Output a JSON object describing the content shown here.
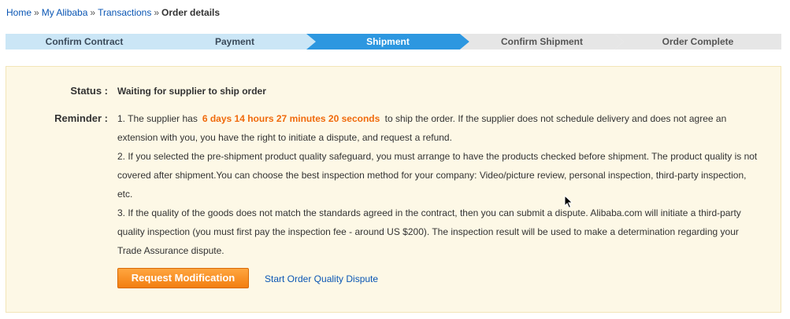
{
  "breadcrumb": {
    "items": [
      "Home",
      "My Alibaba",
      "Transactions"
    ],
    "separator": "»",
    "current": "Order details"
  },
  "steps": [
    {
      "label": "Confirm Contract",
      "state": "done"
    },
    {
      "label": "Payment",
      "state": "done"
    },
    {
      "label": "Shipment",
      "state": "current"
    },
    {
      "label": "Confirm Shipment",
      "state": "pending"
    },
    {
      "label": "Order Complete",
      "state": "pending"
    }
  ],
  "colors": {
    "step_done_bg": "#cbe6f6",
    "step_done_text": "#3a4a5a",
    "step_current_bg": "#2d97e0",
    "step_current_text": "#ffffff",
    "step_pending_bg": "#e6e6e6",
    "step_pending_text": "#555555",
    "panel_bg": "#fdf8e6",
    "countdown": "#f06a0c",
    "link": "#0a56b4",
    "button": "#f58a1f"
  },
  "status": {
    "label": "Status :",
    "value": "Waiting for supplier to ship order"
  },
  "reminder": {
    "label": "Reminder :",
    "line1_prefix": "1. The supplier has",
    "countdown": "6 days 14 hours 27 minutes 20 seconds",
    "line1_suffix": "to ship the order. If the supplier does not schedule delivery and does not agree an extension with you, you have the right to initiate a dispute, and request a refund.",
    "line2": "2. If you selected the pre-shipment product quality safeguard, you must arrange to have the products checked before shipment. The product quality is not covered after shipment.You can choose the best inspection method for your company: Video/picture review, personal inspection, third-party inspection, etc.",
    "line3": "3. If the quality of the goods does not match the standards agreed in the contract, then you can submit a dispute. Alibaba.com will initiate a third-party quality inspection (you must first pay the inspection fee - around US $200). The inspection result will be used to make a determination regarding your Trade Assurance dispute."
  },
  "actions": {
    "request_modification": "Request Modification",
    "start_dispute": "Start Order Quality Dispute"
  }
}
